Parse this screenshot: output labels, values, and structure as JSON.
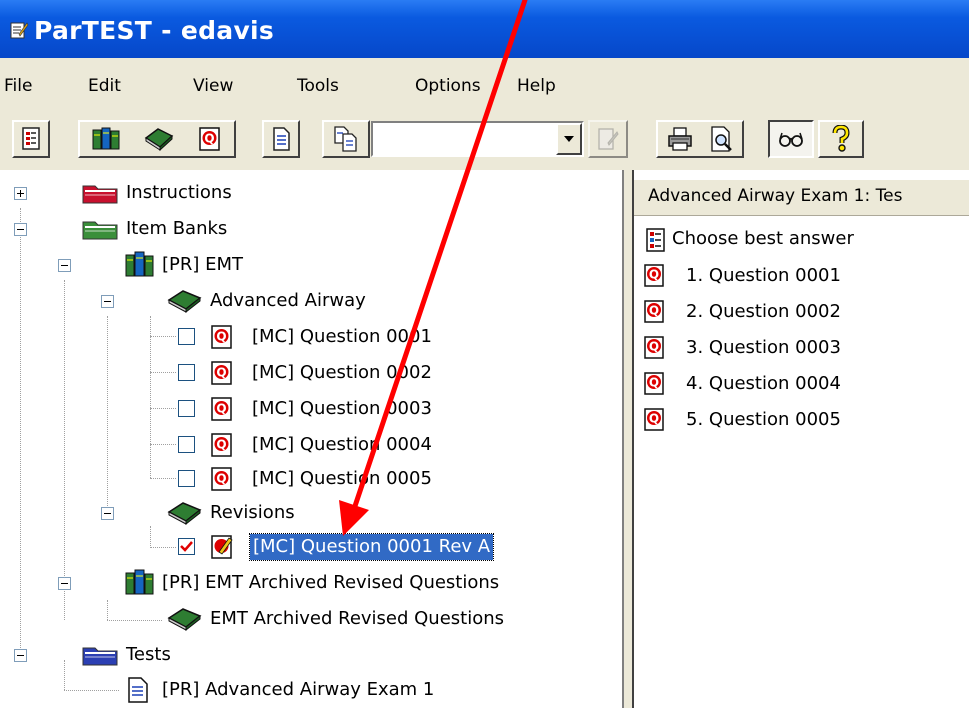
{
  "window": {
    "title": "ParTEST - edavis"
  },
  "menu": [
    "File",
    "Edit",
    "View",
    "Tools",
    "Options",
    "Help"
  ],
  "toolbar": {
    "combo_value": ""
  },
  "tree": {
    "instructions": "Instructions",
    "item_banks": "Item Banks",
    "pr_emt": "[PR] EMT",
    "advanced_airway": "Advanced Airway",
    "questions": [
      "[MC] Question 0001",
      "[MC] Question 0002",
      "[MC] Question 0003",
      "[MC] Question 0004",
      "[MC] Question 0005"
    ],
    "revisions": "Revisions",
    "revision_item": "[MC] Question 0001 Rev A",
    "pr_emt_archived": "[PR] EMT Archived Revised Questions",
    "emt_archived": "EMT Archived Revised Questions",
    "tests": "Tests",
    "test_item": "[PR] Advanced Airway Exam 1"
  },
  "right_pane": {
    "header": "Advanced Airway Exam 1: Tes",
    "section": "Choose best answer",
    "items": [
      "1. Question 0001",
      "2. Question 0002",
      "3. Question 0003",
      "4. Question 0004",
      "5. Question 0005"
    ]
  },
  "colors": {
    "titlebar": "#0a5ae0",
    "selection": "#316ac5",
    "annotation_arrow": "#ff0000",
    "folder_instructions": "#c8102e",
    "folder_item_banks": "#3a8f3a",
    "folder_tests": "#2b3fb3"
  }
}
